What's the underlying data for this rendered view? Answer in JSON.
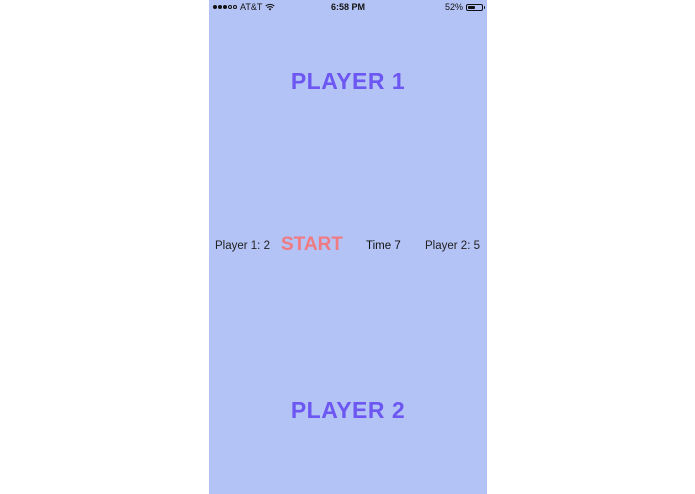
{
  "status_bar": {
    "carrier": "AT&T",
    "time": "6:58 PM",
    "battery_percent_label": "52%",
    "battery_level": 0.52,
    "signal_bars_filled": 3,
    "signal_bars_total": 5,
    "wifi_icon": "wifi-icon"
  },
  "game": {
    "player1_label": "PLAYER 1",
    "player2_label": "PLAYER 2",
    "player1_score": "Player 1: 2",
    "player2_score": "Player 2: 5",
    "start_label": "START",
    "timer": "Time 7"
  },
  "colors": {
    "background": "#b4c3f5",
    "player_label": "#6c57f2",
    "start_button": "#ef7a82"
  }
}
